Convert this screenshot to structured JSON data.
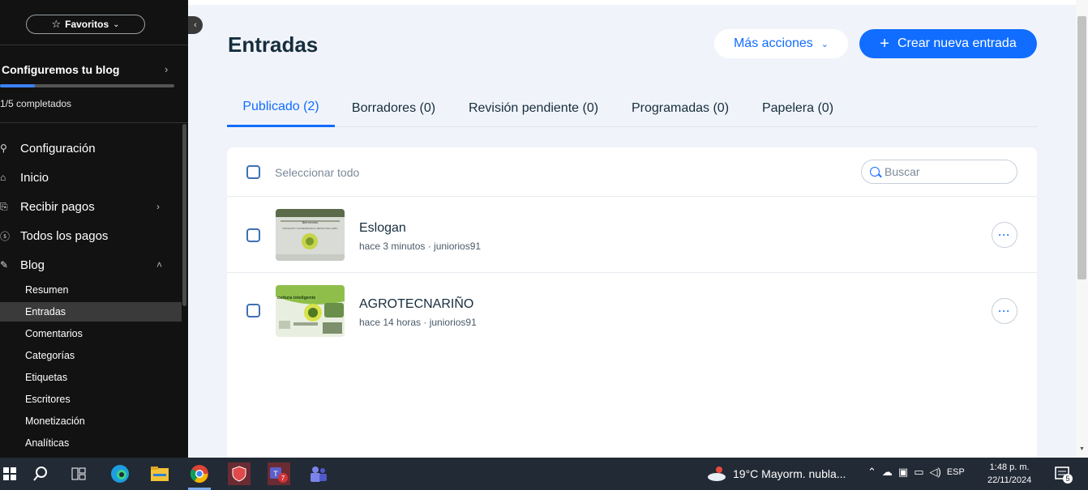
{
  "sidebar": {
    "favorites_label": "Favoritos",
    "setup": {
      "title": "Configuremos tu blog",
      "progress_text": "1/5 completados",
      "progress": 0.2
    },
    "nav": [
      {
        "label": "Configuración",
        "icon": "rocket-icon"
      },
      {
        "label": "Inicio",
        "icon": "home-icon"
      },
      {
        "label": "Recibir pagos",
        "icon": "payment-icon",
        "has_arrow": true
      },
      {
        "label": "Todos los pagos",
        "icon": "dollar-icon"
      },
      {
        "label": "Blog",
        "icon": "pen-icon",
        "expanded": true
      }
    ],
    "blog_sub": [
      {
        "label": "Resumen"
      },
      {
        "label": "Entradas",
        "active": true
      },
      {
        "label": "Comentarios"
      },
      {
        "label": "Categorías"
      },
      {
        "label": "Etiquetas"
      },
      {
        "label": "Escritores"
      },
      {
        "label": "Monetización"
      },
      {
        "label": "Analíticas"
      }
    ]
  },
  "header": {
    "title": "Entradas",
    "more_actions": "Más acciones",
    "create": "Crear nueva entrada"
  },
  "tabs": [
    {
      "label": "Publicado (2)",
      "active": true
    },
    {
      "label": "Borradores (0)"
    },
    {
      "label": "Revisión pendiente (0)"
    },
    {
      "label": "Programadas (0)"
    },
    {
      "label": "Papelera (0)"
    }
  ],
  "list": {
    "select_all": "Seleccionar todo",
    "search_placeholder": "Buscar",
    "posts": [
      {
        "title": "Eslogan",
        "meta": "hace 3 minutos · juniorios91",
        "thumb_caption": "Bienvenido",
        "thumb_line": "INNOVACIÓN Y SOSTENIBILIDAD AL SERVICIO DEL CAMPO"
      },
      {
        "title": "AGROTECNARIÑO",
        "meta": "hace 14 horas · juniorios91",
        "thumb_caption": "cultura inteligente"
      }
    ]
  },
  "taskbar": {
    "weather": "19°C  Mayorm. nubla...",
    "lang": "ESP",
    "time": "1:48 p. m.",
    "date": "22/11/2024",
    "teams_badge": "7",
    "notif_count": "5"
  },
  "colors": {
    "accent": "#116dff",
    "sidebar_bg": "#121212",
    "taskbar_bg": "#222a35"
  }
}
